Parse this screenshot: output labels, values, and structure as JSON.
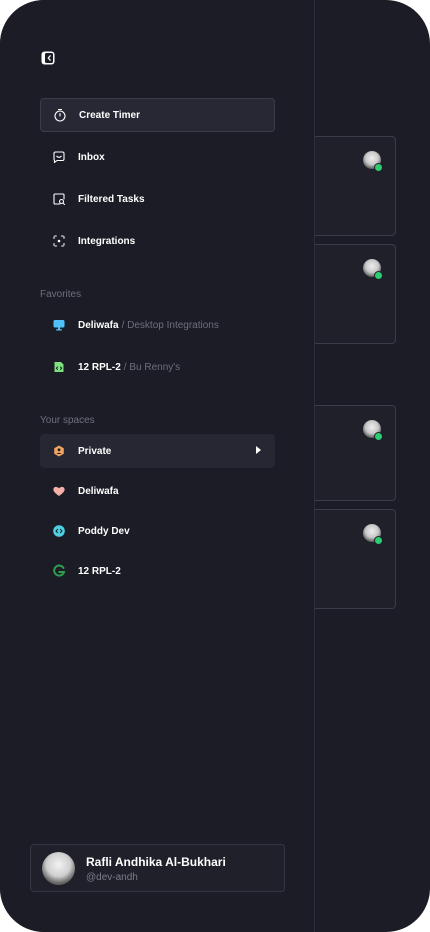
{
  "menu": {
    "items": [
      {
        "label": "Create Timer",
        "icon": "timer-icon",
        "active": true
      },
      {
        "label": "Inbox",
        "icon": "inbox-icon"
      },
      {
        "label": "Filtered Tasks",
        "icon": "filtered-tasks-icon"
      },
      {
        "label": "Integrations",
        "icon": "integrations-icon"
      }
    ]
  },
  "favorites": {
    "title": "Favorites",
    "items": [
      {
        "label": "Deliwafa",
        "sublabel": "/ Desktop Integrations",
        "icon": "monitor-icon",
        "color": "#4fc3f7"
      },
      {
        "label": "12 RPL-2",
        "sublabel": "/ Bu Renny's",
        "icon": "code-file-icon",
        "color": "#7ee07e"
      }
    ]
  },
  "spaces": {
    "title": "Your spaces",
    "items": [
      {
        "label": "Private",
        "icon": "private-space-icon",
        "color": "#f0a35e",
        "selected": true
      },
      {
        "label": "Deliwafa",
        "icon": "heart-icon",
        "color": "#f4b0a8"
      },
      {
        "label": "Poddy Dev",
        "icon": "code-bubble-icon",
        "color": "#4dd0e1"
      },
      {
        "label": "12 RPL-2",
        "icon": "google-icon",
        "color": "#2e9e4f"
      }
    ]
  },
  "profile": {
    "name": "Rafli Andhika Al-Bukhari",
    "handle": "@dev-andh"
  },
  "colors": {
    "background": "#1b1c25",
    "online": "#2ecc71",
    "muted_text": "#6d6f7c"
  }
}
